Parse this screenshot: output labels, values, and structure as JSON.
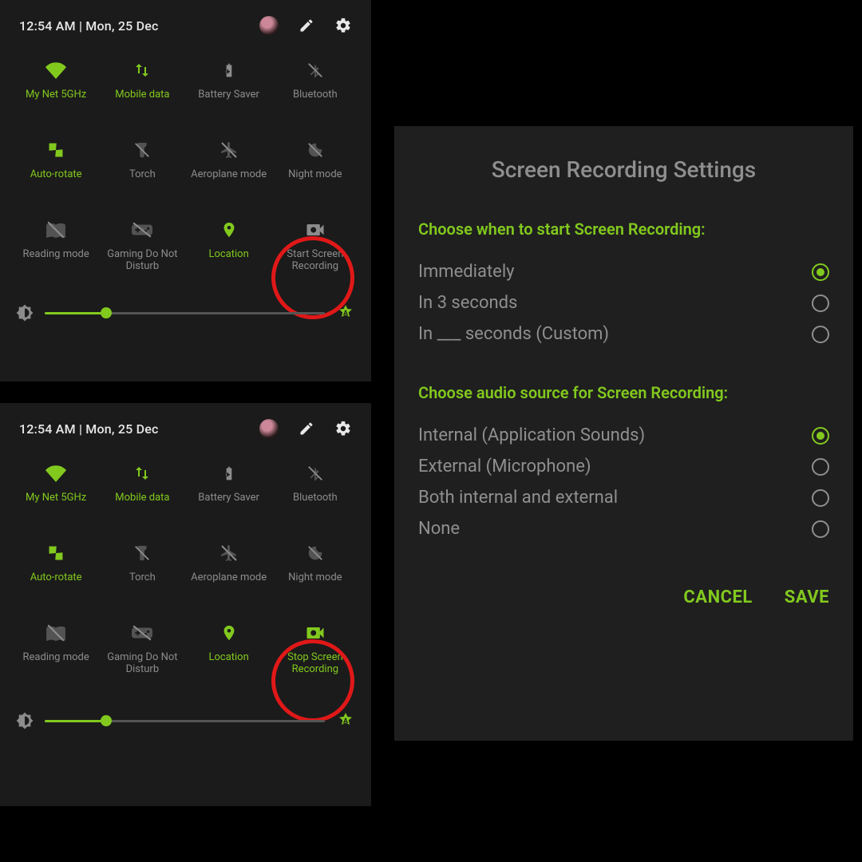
{
  "header": {
    "clock": "12:54 AM  |  Mon, 25 Dec"
  },
  "tiles": {
    "wifi": "My Net 5GHz",
    "mobile_data": "Mobile data",
    "battery_saver": "Battery Saver",
    "bluetooth": "Bluetooth",
    "auto_rotate": "Auto-rotate",
    "torch": "Torch",
    "aeroplane": "Aeroplane mode",
    "night_mode": "Night mode",
    "reading_mode": "Reading mode",
    "gaming_dnd": "Gaming Do Not Disturb",
    "location": "Location",
    "start_rec": "Start Screen Recording",
    "stop_rec": "Stop Screen Recording"
  },
  "brightness": {
    "percent": 22
  },
  "dialog": {
    "title": "Screen Recording Settings",
    "section_when": "Choose when to start Screen Recording:",
    "opt_immediately": "Immediately",
    "opt_3s": "In 3 seconds",
    "opt_custom": "In ___ seconds (Custom)",
    "section_audio": "Choose audio source for Screen Recording:",
    "opt_internal": "Internal (Application Sounds)",
    "opt_external": "External (Microphone)",
    "opt_both": "Both internal and external",
    "opt_none": "None",
    "cancel": "CANCEL",
    "save": "SAVE"
  }
}
